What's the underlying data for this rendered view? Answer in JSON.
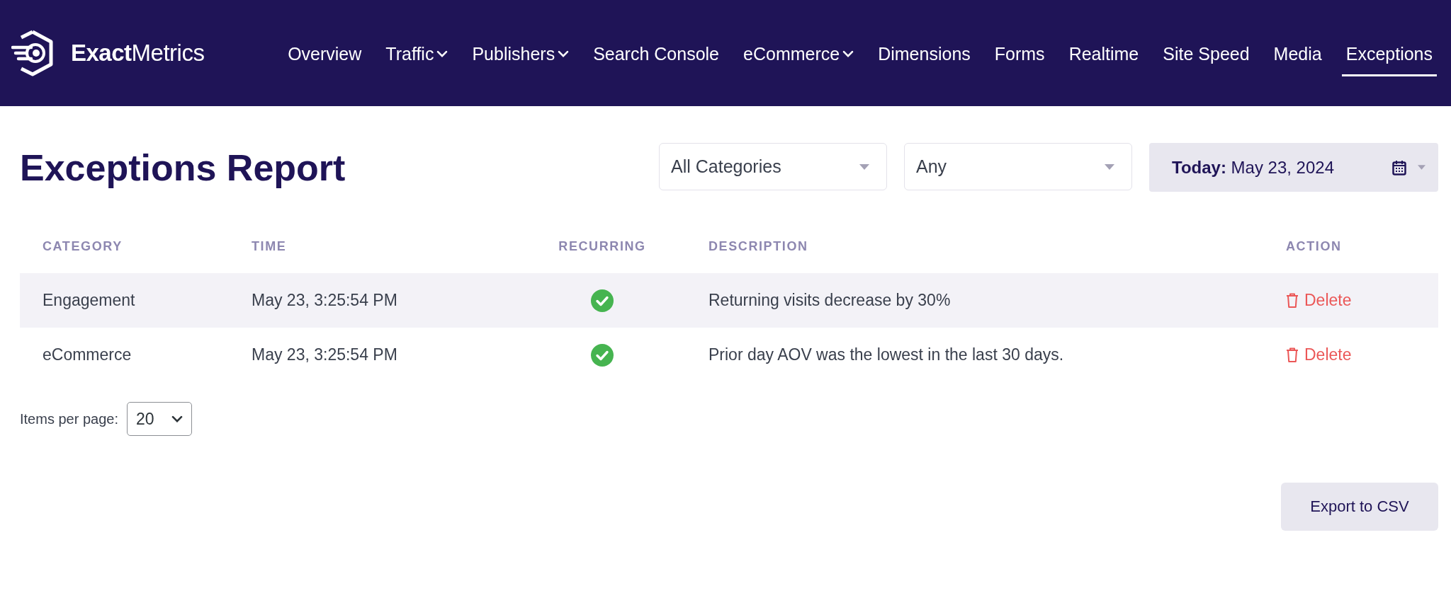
{
  "brand": {
    "name": "**Exact**Metrics"
  },
  "nav": [
    {
      "label": "Overview",
      "dropdown": false,
      "selected": false
    },
    {
      "label": "Traffic",
      "dropdown": true,
      "selected": false
    },
    {
      "label": "Publishers",
      "dropdown": true,
      "selected": false
    },
    {
      "label": "Search Console",
      "dropdown": false,
      "selected": false
    },
    {
      "label": "eCommerce",
      "dropdown": true,
      "selected": false
    },
    {
      "label": "Dimensions",
      "dropdown": false,
      "selected": false
    },
    {
      "label": "Forms",
      "dropdown": false,
      "selected": false
    },
    {
      "label": "Realtime",
      "dropdown": false,
      "selected": false
    },
    {
      "label": "Site Speed",
      "dropdown": false,
      "selected": false
    },
    {
      "label": "Media",
      "dropdown": false,
      "selected": false
    },
    {
      "label": "Exceptions",
      "dropdown": false,
      "selected": true
    }
  ],
  "page": {
    "title": "Exceptions Report"
  },
  "filters": {
    "category": "All Categories",
    "recurring": "Any",
    "date": "**Today:** May 23, 2024"
  },
  "table": {
    "columns": [
      "CATEGORY",
      "TIME",
      "RECURRING",
      "DESCRIPTION",
      "ACTION"
    ],
    "rows": [
      {
        "category": "Engagement",
        "time": "May 23, 3:25:54 PM",
        "recurring": true,
        "description": "Returning visits decrease by 30%",
        "action": "Delete"
      },
      {
        "category": "eCommerce",
        "time": "May 23, 3:25:54 PM",
        "recurring": true,
        "description": "Prior day AOV was the lowest in the last 30 days.",
        "action": "Delete"
      }
    ]
  },
  "pagination": {
    "label": "Items per page:",
    "value": "20"
  },
  "export": {
    "label": "Export to CSV"
  }
}
